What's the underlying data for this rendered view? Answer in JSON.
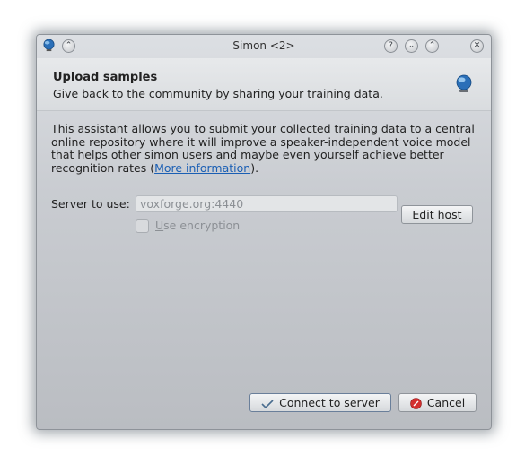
{
  "window": {
    "title": "Simon <2>",
    "buttons": {
      "help": "?",
      "minimize": "⌄",
      "maximize": "⌃",
      "close": "✕",
      "keep_above": "⌃"
    }
  },
  "header": {
    "title": "Upload samples",
    "subtitle": "Give back to the community by sharing your training data."
  },
  "description": {
    "text": "This assistant allows you to submit your collected training data to a central online repository where it will improve a speaker-independent voice model that helps other simon users and maybe even yourself achieve better recognition rates (",
    "link_text": "More information",
    "suffix": ")."
  },
  "server": {
    "label": "Server to use:",
    "value": "voxforge.org:4440",
    "edit_host_label": "Edit host"
  },
  "encryption": {
    "label_first": "U",
    "label_rest": "se encryption",
    "checked": false
  },
  "footer": {
    "connect_label_a": "Connect ",
    "connect_label_u": "t",
    "connect_label_b": "o server",
    "cancel_label_u": "C",
    "cancel_label_rest": "ancel"
  },
  "colors": {
    "accent_link": "#1a5fb4",
    "cancel_icon": "#d32f2f"
  }
}
